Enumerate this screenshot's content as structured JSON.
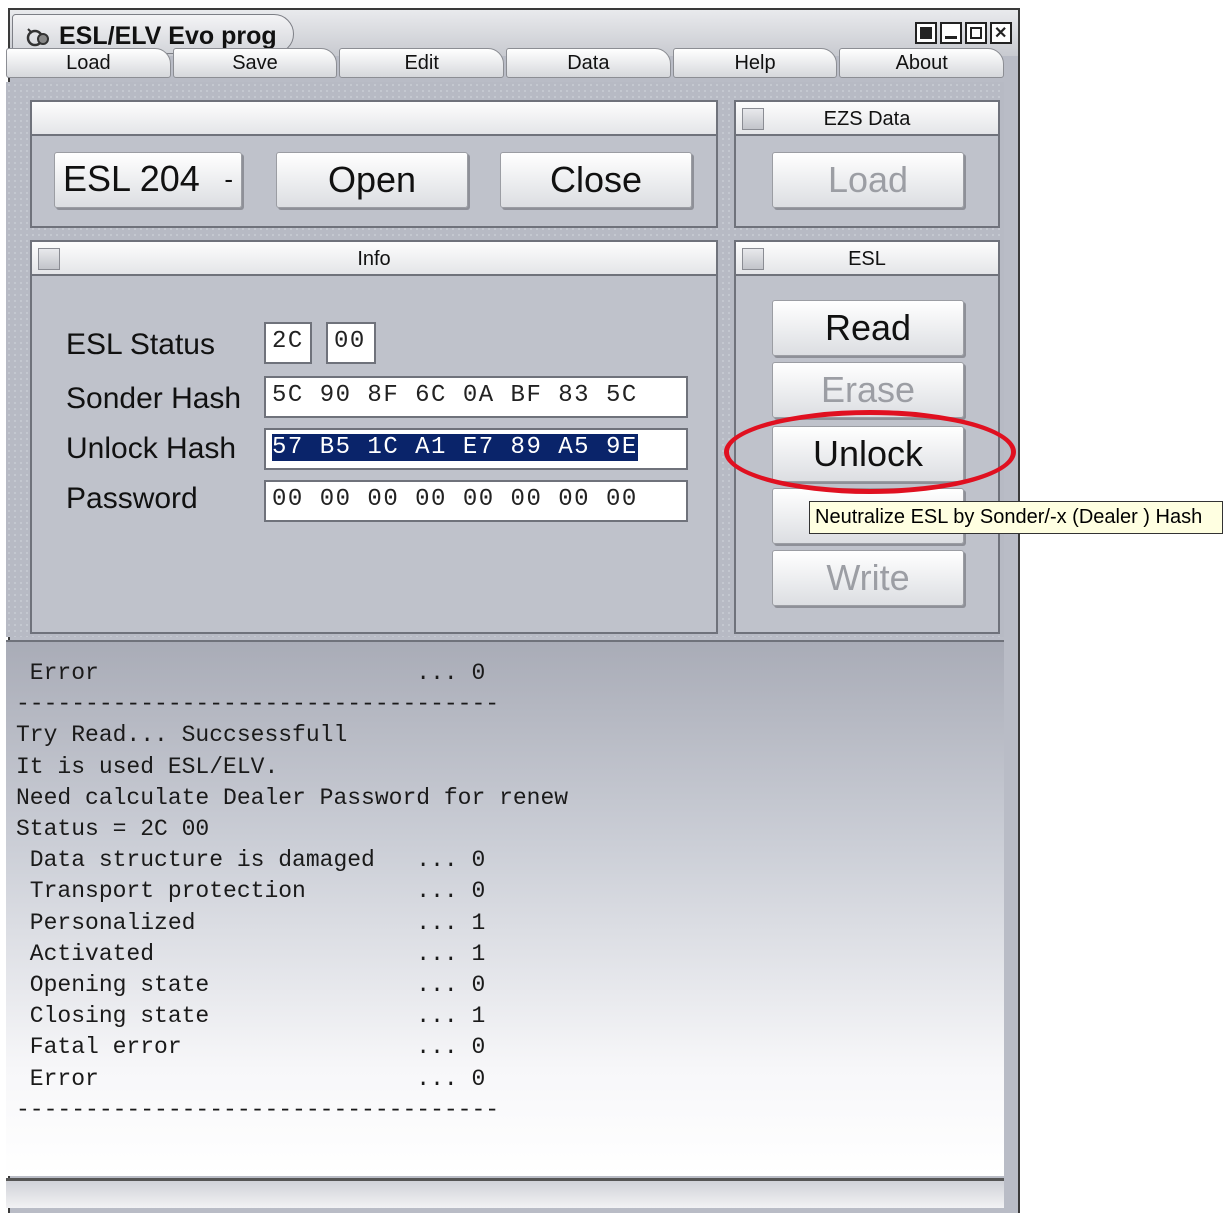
{
  "window": {
    "title": "ESL/ELV Evo prog"
  },
  "menu": {
    "items": [
      "Load",
      "Save",
      "Edit",
      "Data",
      "Help",
      "About"
    ]
  },
  "device": {
    "combo_value": "ESL 204",
    "open_label": "Open",
    "close_label": "Close"
  },
  "ezs": {
    "title": "EZS Data",
    "load_label": "Load"
  },
  "info": {
    "title": "Info",
    "status_label": "ESL Status",
    "status_values": [
      "2C",
      "00"
    ],
    "sonder_label": "Sonder Hash",
    "sonder_value": "5C 90 8F 6C 0A BF 83 5C",
    "unlock_label": "Unlock Hash",
    "unlock_value": "57 B5 1C A1 E7 89 A5 9E",
    "password_label": "Password",
    "password_value": "00 00 00 00 00 00 00 00"
  },
  "esl": {
    "title": "ESL",
    "read_label": "Read",
    "erase_label": "Erase",
    "unlock_label": "Unlock",
    "write_label": "Write"
  },
  "tooltip": {
    "text": "Neutralize ESL by Sonder/-x (Dealer ) Hash"
  },
  "log": {
    "lines": [
      " Error                       ... 0",
      "-----------------------------------",
      "Try Read... Succsessfull",
      "It is used ESL/ELV.",
      "Need calculate Dealer Password for renew",
      "Status = 2C 00",
      " Data structure is damaged   ... 0",
      " Transport protection        ... 0",
      " Personalized                ... 1",
      " Activated                   ... 1",
      " Opening state               ... 0",
      " Closing state               ... 1",
      " Fatal error                 ... 0",
      " Error                       ... 0",
      "-----------------------------------"
    ]
  },
  "colors": {
    "highlight": "#e01020",
    "selection": "#0a246a",
    "tooltip_bg": "#ffffe1"
  }
}
